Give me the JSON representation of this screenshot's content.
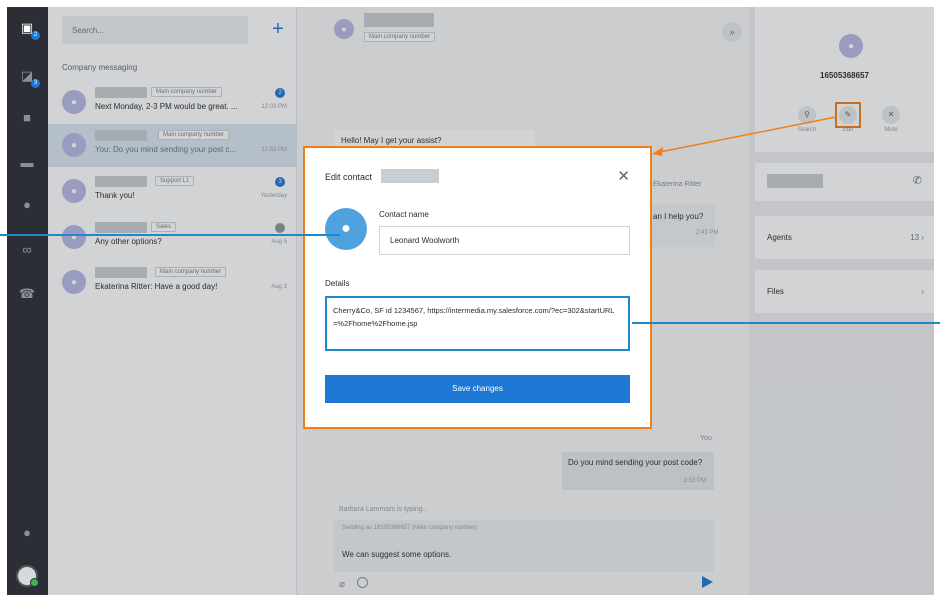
{
  "colors": {
    "accent": "#1e78d4",
    "highlight": "#f07f1a",
    "callout": "#1e88c8",
    "rail": "#2b2f35"
  },
  "rail": {
    "items": [
      {
        "icon": "contacts-icon",
        "badge": "2"
      },
      {
        "icon": "chat-icon",
        "badge": "3"
      },
      {
        "icon": "video-icon"
      },
      {
        "icon": "folder-icon"
      },
      {
        "icon": "clock-icon"
      },
      {
        "icon": "voicemail-icon"
      },
      {
        "icon": "phone-icon"
      }
    ]
  },
  "list": {
    "search_placeholder": "Search...",
    "section_title": "Company messaging",
    "conversations": [
      {
        "tag": "Main company number",
        "preview": "Next Monday, 2-3 PM would be great. ...",
        "time": "12:03 PM",
        "unread": "2"
      },
      {
        "tag": "Main company number",
        "preview": "You: Do you mind sending your post c...",
        "time": "12:53 PM"
      },
      {
        "tag": "Support L1",
        "preview": "Thank you!",
        "time": "Yesterday",
        "unread": "3"
      },
      {
        "tag": "Sales",
        "preview": "Any other options?",
        "time": "Aug 5"
      },
      {
        "tag": "Main company number",
        "preview": "Ekaterina Ritter: Have a good day!",
        "time": "Aug 3"
      }
    ]
  },
  "chat": {
    "header_tag": "Main company number",
    "incoming": "Hello! May I get your assist?",
    "peek_name": "Ekaterina Ritter",
    "peek_text": "an I help you?",
    "peek_time": "2:43 PM",
    "you_label": "You",
    "outgoing": "Do you mind sending your post code?",
    "outgoing_time": "2:53 PM",
    "typing": "Barbara Lammars is typing...",
    "compose_hint": "Sending as 16505368657 (Main company number)",
    "compose_text": "We can suggest some options."
  },
  "panel": {
    "number": "16505368657",
    "actions": [
      {
        "label": "Search",
        "icon": "search-icon"
      },
      {
        "label": "Edit",
        "icon": "pencil-icon"
      },
      {
        "label": "Mute",
        "icon": "mute-icon"
      }
    ],
    "agents_label": "Agents",
    "agents_count": "13",
    "files_label": "Files"
  },
  "modal": {
    "title": "Edit contact",
    "contact_name_label": "Contact name",
    "contact_name_value": "Leonard Woolworth",
    "details_label": "Details",
    "details_value": "Cherry&Co, SF id 1234567, https://intermedia.my.salesforce.com/?ec=302&startURL=%2Fhome%2Fhome.jsp",
    "save_label": "Save changes"
  }
}
